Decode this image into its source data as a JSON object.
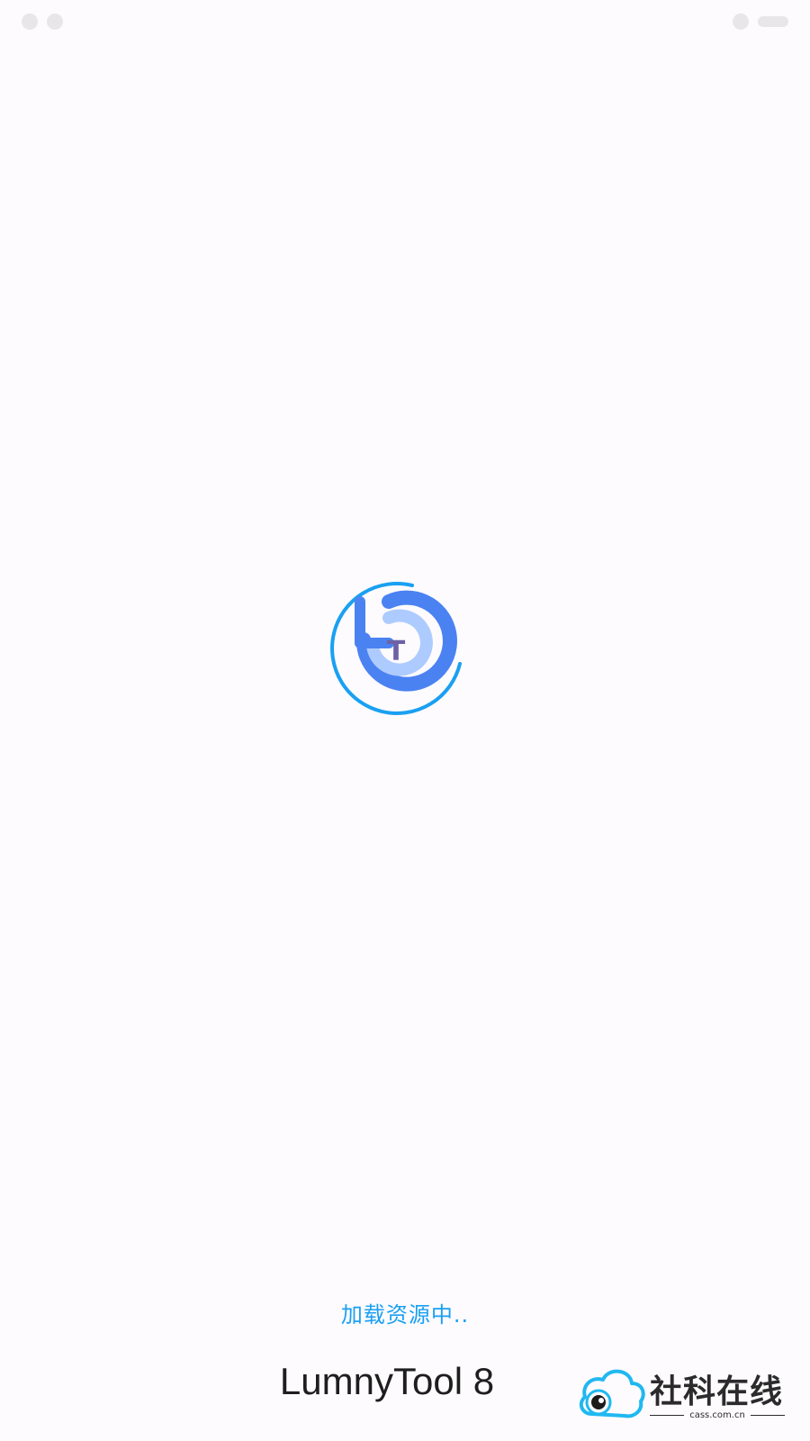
{
  "app": {
    "name": "LumnyTool 8",
    "loading_text": "加载资源中.."
  },
  "logo": {
    "icon": "lumnytool-logo-icon",
    "letters": {
      "l": "L",
      "t": "T"
    },
    "colors": {
      "outer_ring": "#1aa0f2",
      "inner_arc": "#4b82f2",
      "light_arc": "#aecbff",
      "t_letter": "#6c62a6"
    }
  },
  "watermark": {
    "text": "社科在线",
    "subtext": "cass.com.cn",
    "icon": "cloud-eye-icon",
    "colors": {
      "cloud": "#20b8f0",
      "text": "#2b2b2b"
    }
  },
  "colors": {
    "background": "#fdfbfe",
    "loading_text": "#1aa0f2",
    "app_name": "#1e1e1e"
  }
}
